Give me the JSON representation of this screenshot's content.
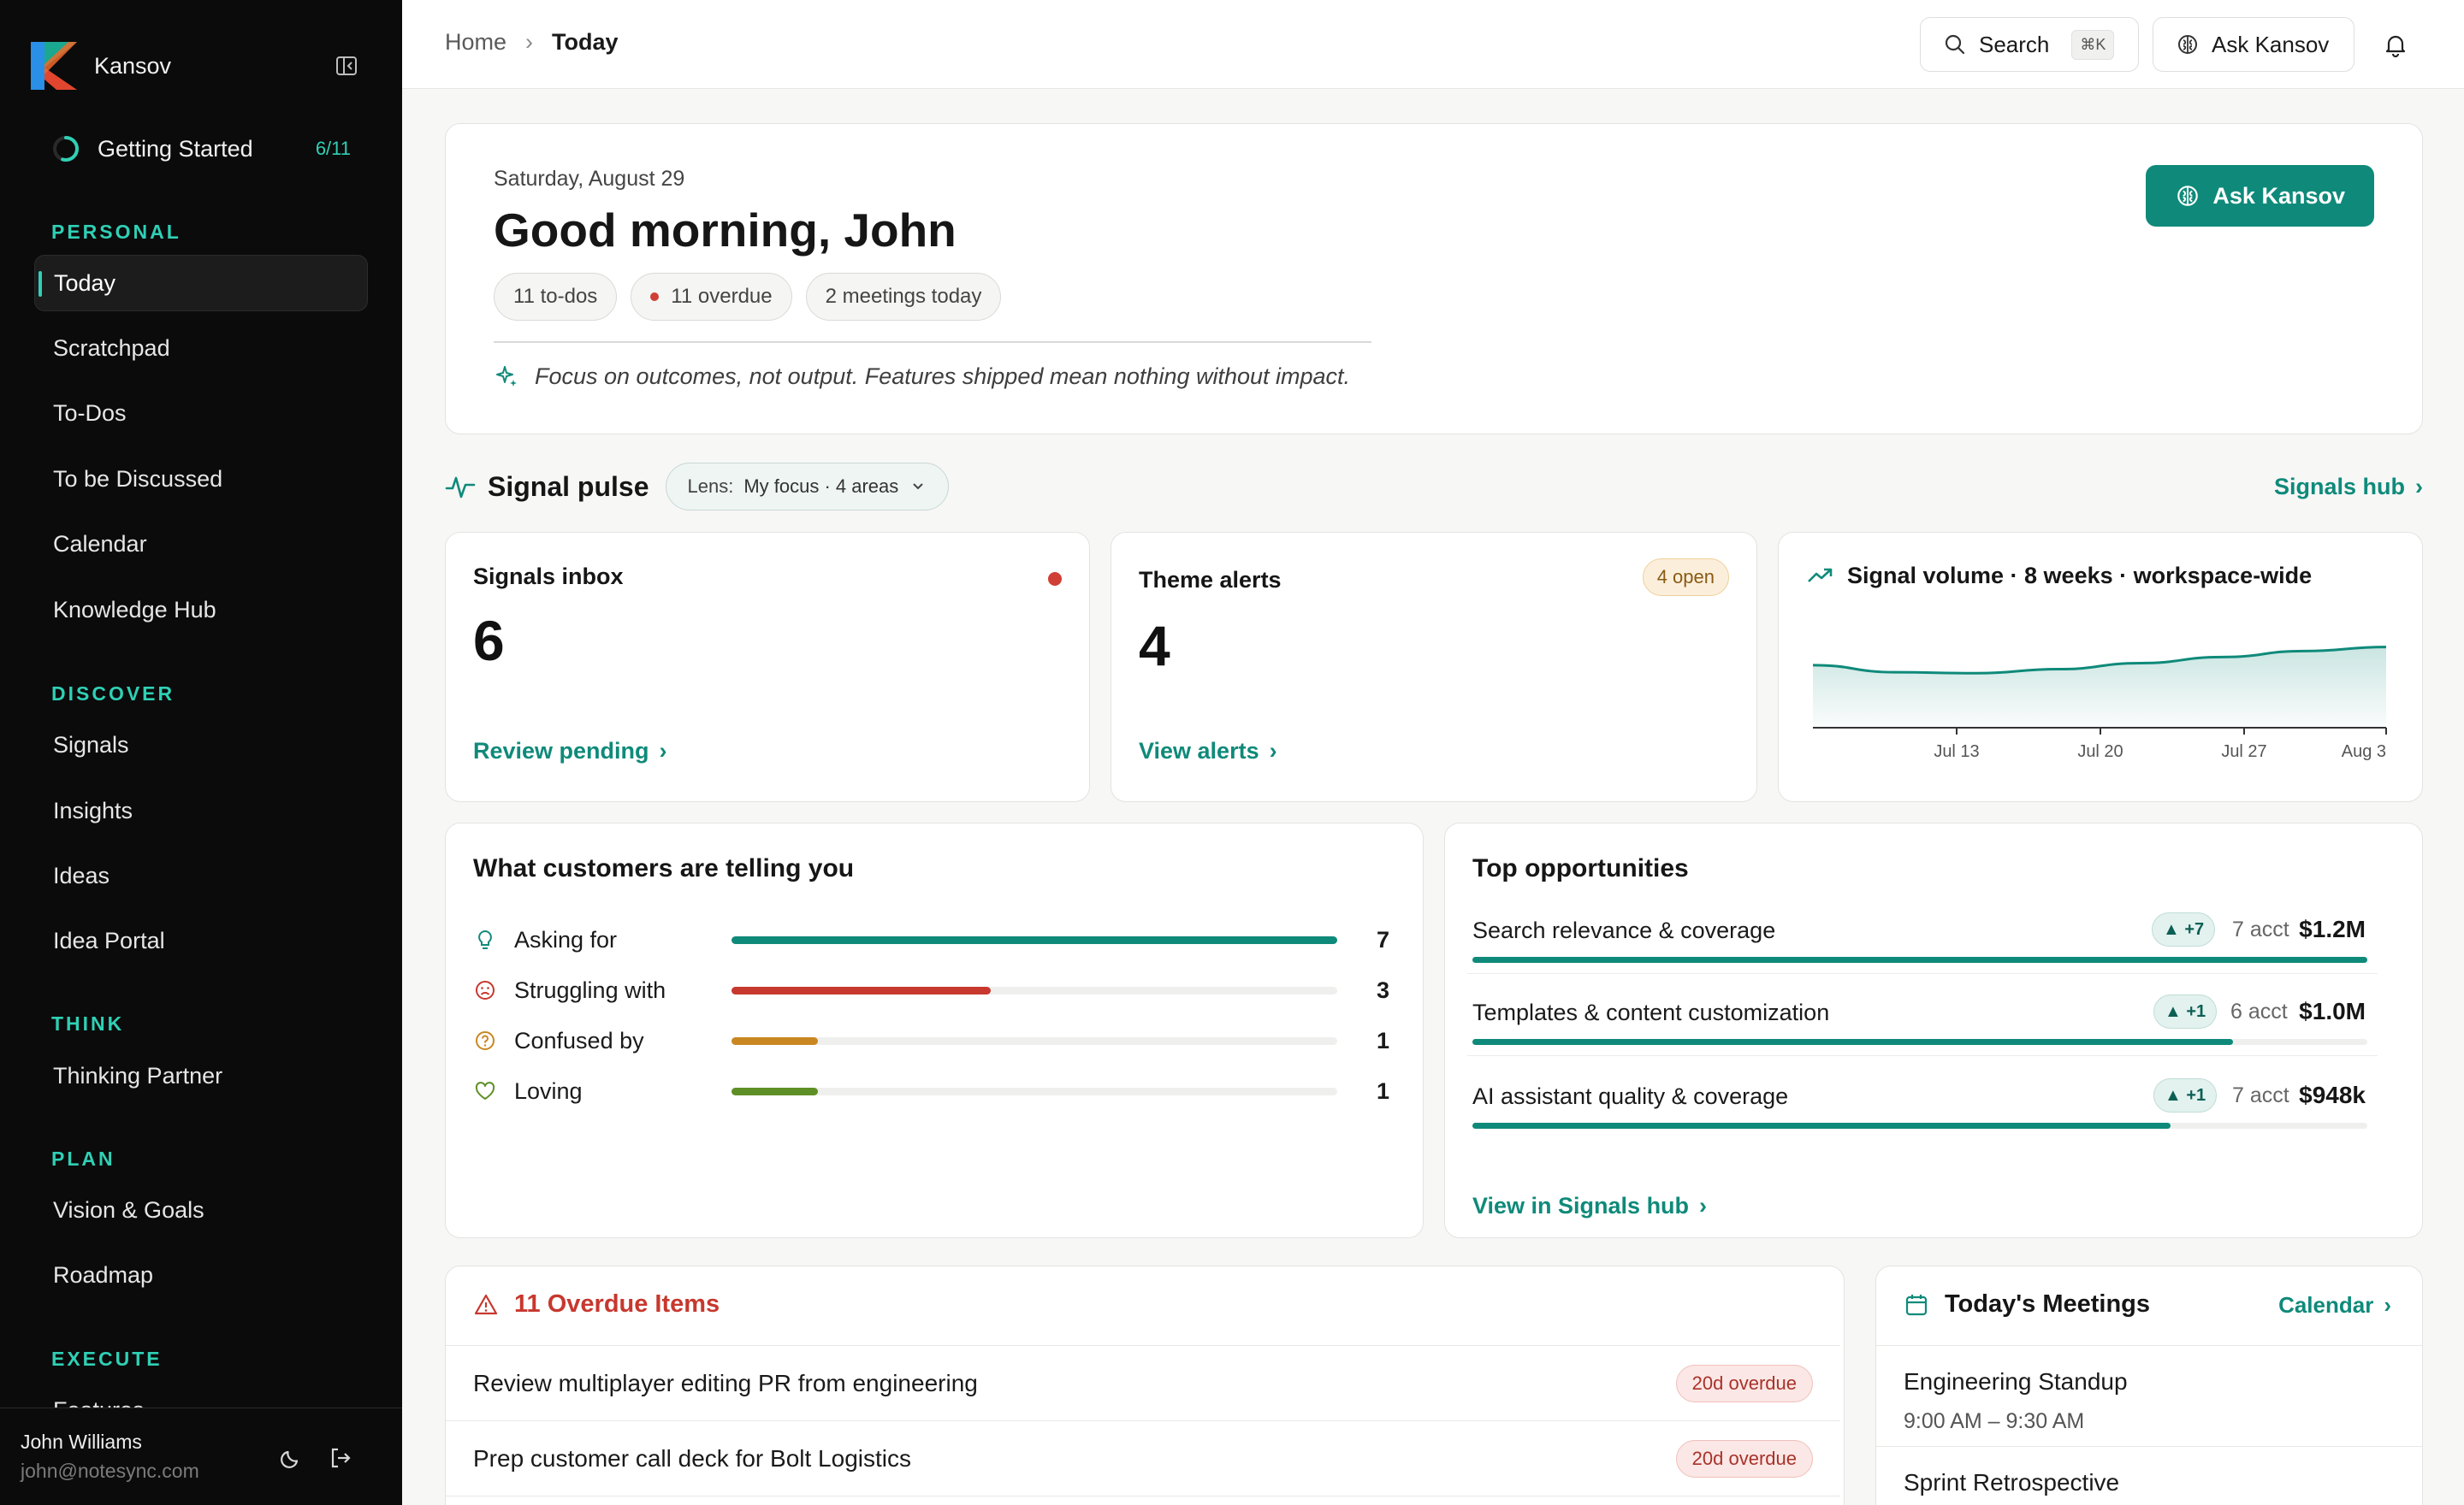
{
  "app": {
    "name": "Kansov"
  },
  "sidebar": {
    "getting_started": {
      "label": "Getting Started",
      "progress": "6/11",
      "fraction": 0.545
    },
    "sections": [
      {
        "title": "PERSONAL",
        "items": [
          "Today",
          "Scratchpad",
          "To-Dos",
          "To be Discussed",
          "Calendar",
          "Knowledge Hub"
        ]
      },
      {
        "title": "DISCOVER",
        "items": [
          "Signals",
          "Insights",
          "Ideas",
          "Idea Portal"
        ]
      },
      {
        "title": "THINK",
        "items": [
          "Thinking Partner"
        ]
      },
      {
        "title": "PLAN",
        "items": [
          "Vision & Goals",
          "Roadmap"
        ]
      },
      {
        "title": "EXECUTE",
        "items": [
          "Features"
        ]
      }
    ],
    "active_item": "Today",
    "user": {
      "name": "John Williams",
      "email": "john@notesync.com"
    }
  },
  "topbar": {
    "breadcrumb": {
      "home": "Home",
      "current": "Today"
    },
    "search_label": "Search",
    "search_shortcut": "⌘K",
    "ask_label": "Ask Kansov"
  },
  "greeting": {
    "date": "Saturday, August 29",
    "title": "Good morning, John",
    "chips": {
      "todos": "11 to-dos",
      "overdue": "11 overdue",
      "meetings": "2 meetings today"
    },
    "quote": "Focus on outcomes, not output. Features shipped mean nothing without impact.",
    "ask_button": "Ask Kansov"
  },
  "signal_pulse": {
    "title": "Signal pulse",
    "lens_key": "Lens:",
    "lens_value": "My focus · 4 areas",
    "hub_link": "Signals hub"
  },
  "signals_inbox": {
    "title": "Signals inbox",
    "value": "6",
    "link": "Review pending"
  },
  "theme_alerts": {
    "title": "Theme alerts",
    "badge": "4 open",
    "value": "4",
    "link": "View alerts"
  },
  "signal_volume": {
    "title": "Signal volume · 8 weeks · workspace-wide"
  },
  "chart_data": {
    "type": "area",
    "title": "Signal volume · 8 weeks · workspace-wide",
    "x_ticks": [
      "Jul 13",
      "Jul 20",
      "Jul 27",
      "Aug 3"
    ],
    "series": [
      {
        "values": [
          0.62,
          0.55,
          0.54,
          0.58,
          0.64,
          0.7,
          0.76,
          0.8
        ]
      }
    ],
    "color": "#0f8a7a",
    "ylim": [
      0,
      1
    ]
  },
  "customers": {
    "title": "What customers are telling you",
    "rows": [
      {
        "label": "Asking for",
        "count": "7",
        "value": 7,
        "color": "#0f8a7a",
        "icon": "lightbulb-icon"
      },
      {
        "label": "Struggling with",
        "count": "3",
        "value": 3,
        "color": "#c7382e",
        "icon": "frown-icon"
      },
      {
        "label": "Confused by",
        "count": "1",
        "value": 1,
        "color": "#c98722",
        "icon": "question-icon"
      },
      {
        "label": "Loving",
        "count": "1",
        "value": 1,
        "color": "#5e8f26",
        "icon": "heart-icon"
      }
    ],
    "max": 7
  },
  "opportunities": {
    "title": "Top opportunities",
    "rows": [
      {
        "name": "Search relevance & coverage",
        "delta": "▲ +7",
        "accounts": "7 acct",
        "value": "$1.2M",
        "share": 1.0
      },
      {
        "name": "Templates & content customization",
        "delta": "▲ +1",
        "accounts": "6 acct",
        "value": "$1.0M",
        "share": 0.85
      },
      {
        "name": "AI assistant quality & coverage",
        "delta": "▲ +1",
        "accounts": "7 acct",
        "value": "$948k",
        "share": 0.78
      }
    ],
    "link": "View in Signals hub"
  },
  "overdue": {
    "title": "11 Overdue Items",
    "items": [
      {
        "title": "Review multiplayer editing PR from engineering",
        "badge": "20d overdue"
      },
      {
        "title": "Prep customer call deck for Bolt Logistics",
        "badge": "20d overdue"
      }
    ]
  },
  "meetings": {
    "title": "Today's Meetings",
    "calendar_link": "Calendar",
    "items": [
      {
        "title": "Engineering Standup",
        "time": "9:00 AM – 9:30 AM"
      },
      {
        "title": "Sprint Retrospective",
        "time": ""
      }
    ]
  }
}
